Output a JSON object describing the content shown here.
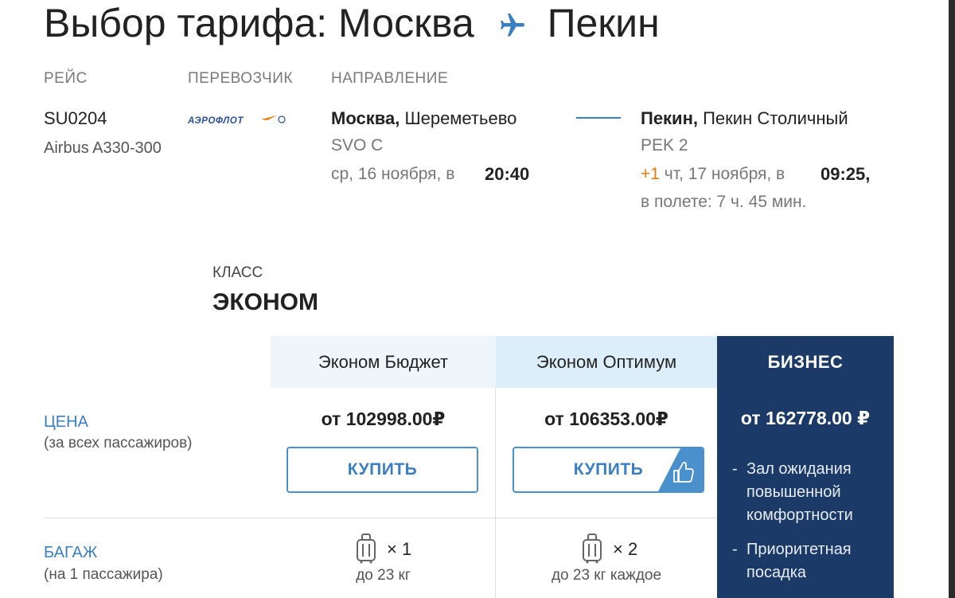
{
  "header": {
    "title_from": "Выбор тарифа: Москва",
    "title_to": "Пекин",
    "plane_icon": "plane-icon"
  },
  "flight": {
    "labels": {
      "flight": "РЕЙС",
      "carrier": "ПЕРЕВОЗЧИК",
      "direction": "НАПРАВЛЕНИЕ"
    },
    "number": "SU0204",
    "aircraft": "Airbus A330-300",
    "carrier_logo_text": "АЭРОФЛОТ",
    "departure": {
      "city": "Москва,",
      "airport": "Шереметьево",
      "code": "SVO C",
      "date": "ср, 16 ноября, в",
      "time": "20:40"
    },
    "arrival": {
      "city": "Пекин,",
      "airport": "Пекин Столичный",
      "code": "PEK 2",
      "day_offset": "+1",
      "date": "чт, 17 ноября, в",
      "time": "09:25,",
      "duration": "в полете: 7 ч. 45 мин."
    }
  },
  "class": {
    "label": "КЛАСС",
    "value": "ЭКОНОМ"
  },
  "fares": {
    "columns": [
      "Эконом Бюджет",
      "Эконом Оптимум",
      "БИЗНЕС"
    ],
    "price_label": "ЦЕНА",
    "price_sub": "(за всех пассажиров)",
    "prices": [
      "от 102998.00₽",
      "от 106353.00₽",
      "от 162778.00 ₽"
    ],
    "buy_label": "КУПИТЬ",
    "recommended_icon": "thumbs-up-icon",
    "baggage_label": "БАГАЖ",
    "baggage_sub": "(на 1 пассажира)",
    "baggage": [
      {
        "count": "× 1",
        "note": "до 23 кг"
      },
      {
        "count": "× 2",
        "note": "до 23 кг каждое"
      }
    ],
    "business_features": [
      "Зал ожидания повышенной комфортности",
      "Приоритетная посадка"
    ]
  },
  "colors": {
    "accent": "#3a7fc1",
    "business_bg": "#1c3a68",
    "offset": "#e8790c"
  }
}
